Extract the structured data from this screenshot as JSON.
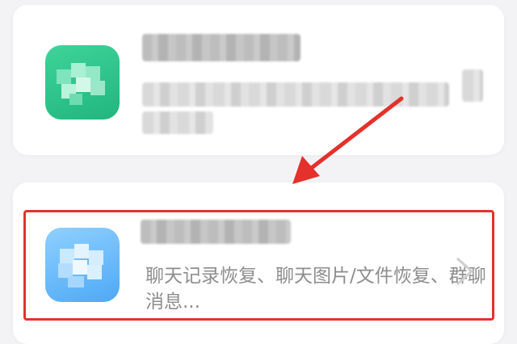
{
  "cards": [
    {
      "title": "",
      "description": "",
      "icon": "app-icon-green-blurred",
      "icon_color": "#2cc48a"
    },
    {
      "title": "",
      "description": "聊天记录恢复、聊天图片/文件恢复、群聊消息...",
      "icon": "app-icon-blue-blurred",
      "icon_color": "#5fb3f7",
      "chevron": "chevron-right-icon"
    }
  ],
  "annotation": {
    "arrow_color": "#e4312b",
    "highlight_color": "#e4312b"
  }
}
